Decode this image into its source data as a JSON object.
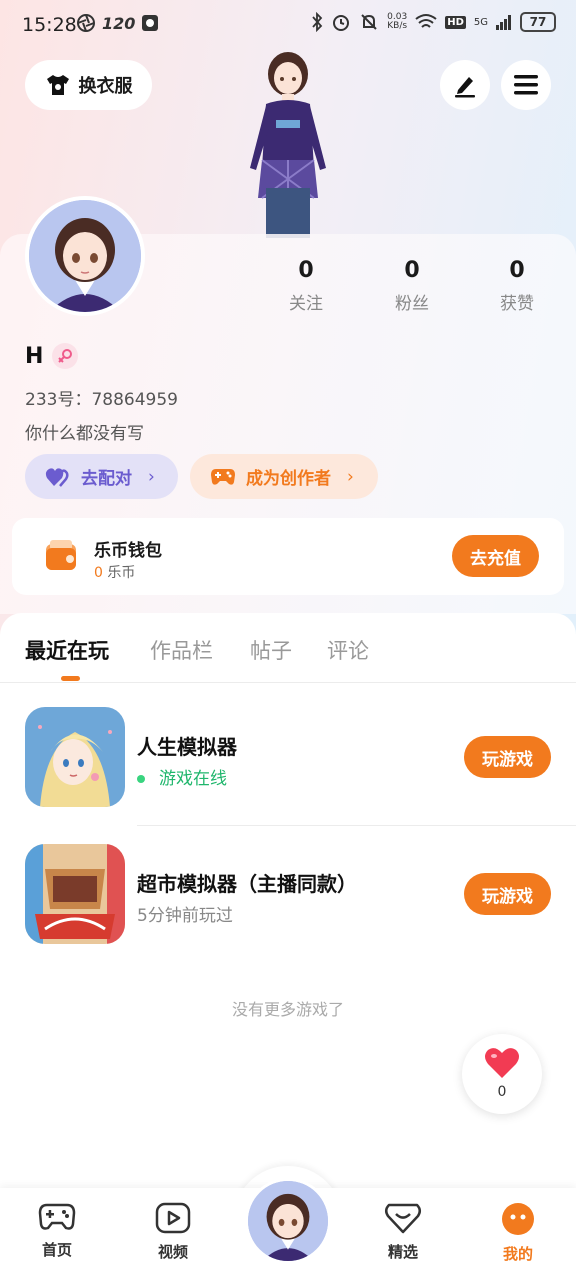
{
  "status_bar": {
    "time": "15:28",
    "refresh_rate": "120",
    "net_speed_value": "0.03",
    "net_speed_unit": "KB/s",
    "hd": "HD",
    "network": "5G",
    "battery": "77"
  },
  "header": {
    "outfit_label": "换衣服",
    "edit_icon": "pencil-icon",
    "menu_icon": "menu-icon"
  },
  "profile": {
    "stats": [
      {
        "value": "0",
        "label": "关注"
      },
      {
        "value": "0",
        "label": "粉丝"
      },
      {
        "value": "0",
        "label": "获赞"
      }
    ],
    "username": "H",
    "gender": "female",
    "id_text": "233号：78864959",
    "bio": "你什么都没有写",
    "match_label": "去配对",
    "creator_label": "成为创作者"
  },
  "wallet": {
    "title": "乐币钱包",
    "balance_value": "0",
    "balance_unit": "乐币",
    "recharge_label": "去充值"
  },
  "tabs": [
    "最近在玩",
    "作品栏",
    "帖子",
    "评论"
  ],
  "games": [
    {
      "title": "人生模拟器",
      "status": "游戏在线",
      "play_label": "玩游戏"
    },
    {
      "title": "超市模拟器（主播同款）",
      "status": "5分钟前玩过",
      "play_label": "玩游戏"
    }
  ],
  "no_more_text": "没有更多游戏了",
  "like_count": "0",
  "bottom_nav": [
    {
      "label": "首页",
      "icon": "gamepad-icon"
    },
    {
      "label": "视频",
      "icon": "video-play-icon"
    },
    {
      "label": "",
      "icon": "avatar-center"
    },
    {
      "label": "精选",
      "icon": "heart-chat-icon"
    },
    {
      "label": "我的",
      "icon": "face-icon"
    }
  ],
  "colors": {
    "accent": "#f27a1e",
    "online": "#1fb66c",
    "match": "#6b5ccf"
  }
}
